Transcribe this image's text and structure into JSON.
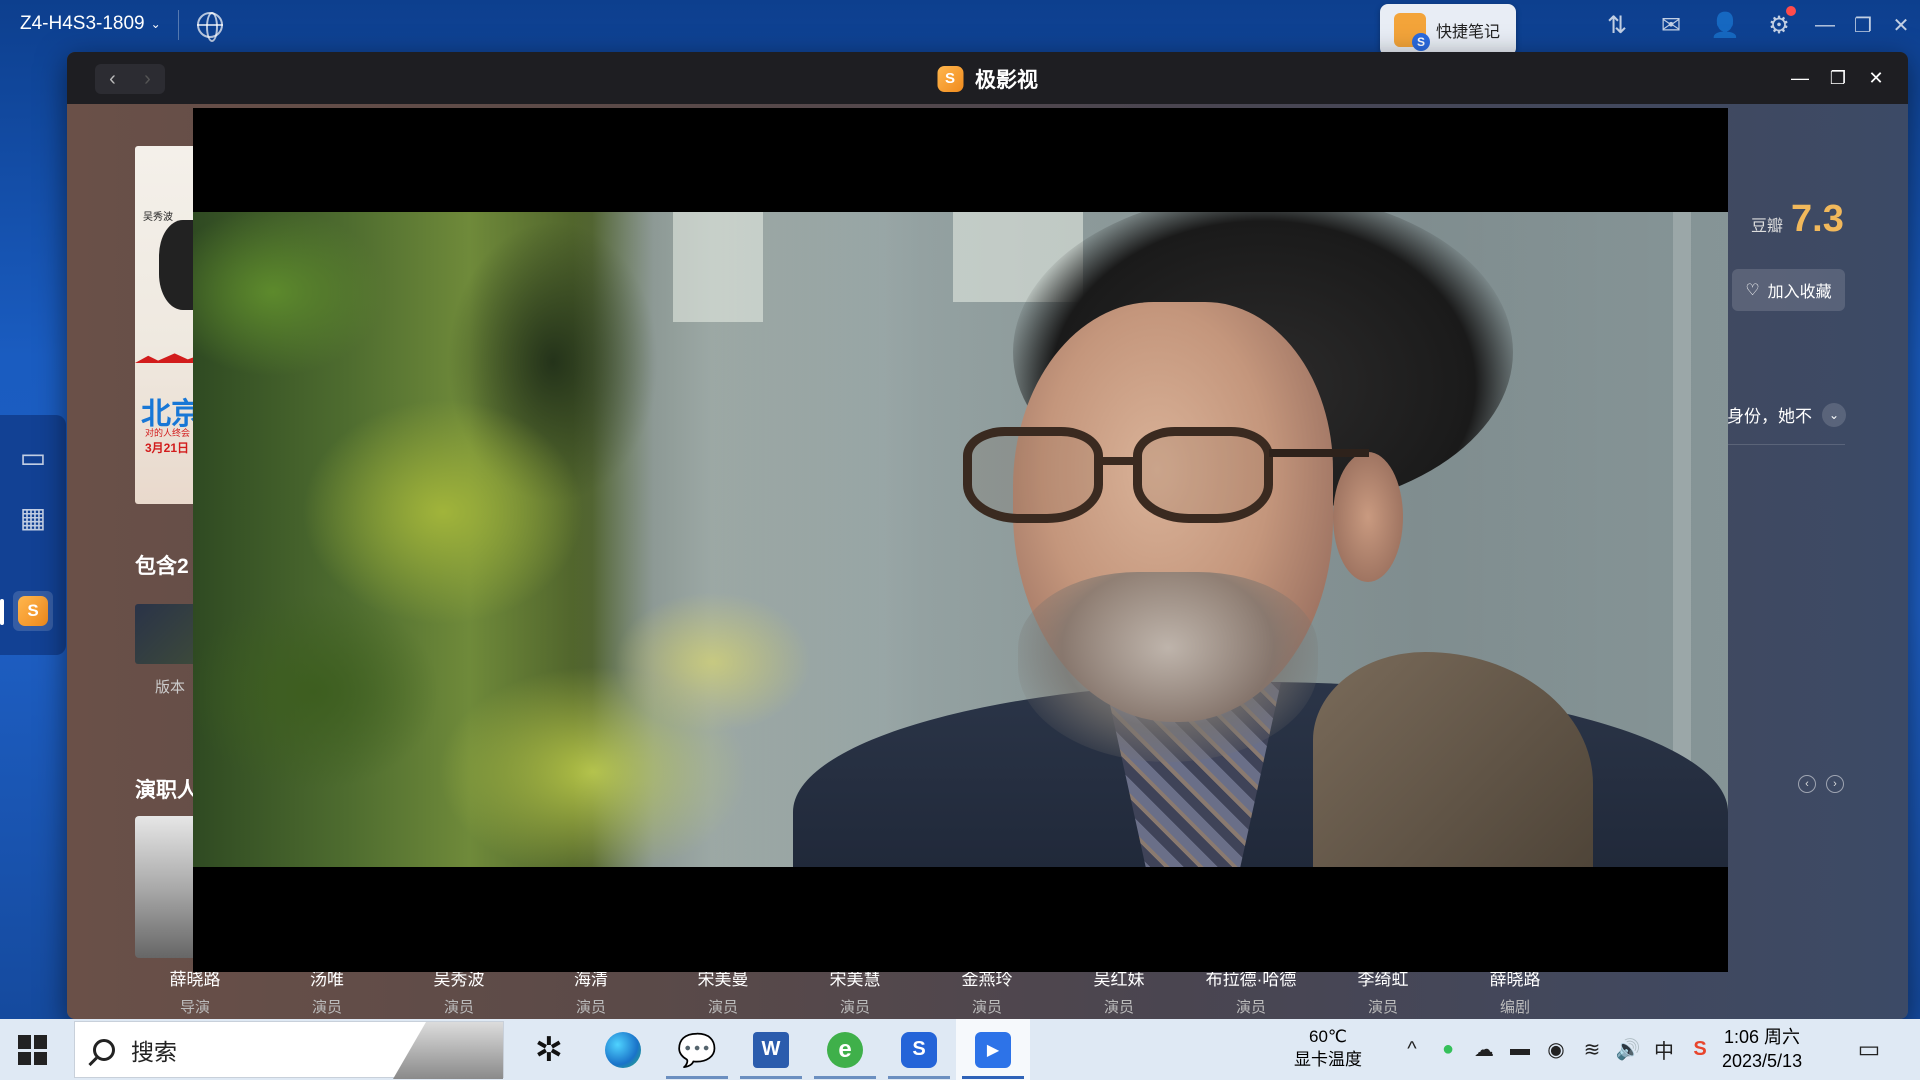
{
  "desktop": {
    "device_name": "Z4-H4S3-1809",
    "device_caret": "⌄",
    "quick_note_label": "快捷笔记",
    "top_icons": [
      "transfer-icon",
      "mail-icon",
      "user-icon",
      "settings-icon",
      "minimize-icon",
      "restore-icon",
      "close-icon"
    ]
  },
  "app": {
    "title": "极影视",
    "logo_glyph": "S",
    "nav_back": "‹",
    "nav_forward": "›",
    "win_min": "—",
    "win_max": "❐",
    "win_close": "✕"
  },
  "detail": {
    "poster": {
      "actor_name": "吴秀波",
      "title_text": "北京",
      "tagline": "对的人终会",
      "date": "3月21日"
    },
    "douban_label": "豆瓣",
    "douban_score": "7.3",
    "collect_label": "加入收藏",
    "collect_glyph": "♡",
    "description_tail": "身份，她不",
    "expand_glyph": "⌄",
    "versions_heading": "包含2",
    "version_label": "版本",
    "cast_heading": "演职人",
    "carousel_prev": "‹",
    "carousel_next": "›",
    "close_glyph": "✕",
    "cast": [
      {
        "name": "薛晓路",
        "role": "导演"
      },
      {
        "name": "汤唯",
        "role": "演员"
      },
      {
        "name": "吴秀波",
        "role": "演员"
      },
      {
        "name": "海清",
        "role": "演员"
      },
      {
        "name": "宋美曼",
        "role": "演员"
      },
      {
        "name": "宋美慧",
        "role": "演员"
      },
      {
        "name": "金燕玲",
        "role": "演员"
      },
      {
        "name": "吴红妹",
        "role": "演员"
      },
      {
        "name": "布拉德·哈德",
        "role": "演员"
      },
      {
        "name": "李绮虹",
        "role": "演员"
      },
      {
        "name": "薛晓路",
        "role": "编剧"
      }
    ]
  },
  "taskbar": {
    "search_placeholder": "搜索",
    "apps": [
      {
        "name": "pinwheel-app",
        "glyph": "✲",
        "running": false,
        "active": false
      },
      {
        "name": "edge-browser",
        "glyph": "",
        "running": false,
        "active": false
      },
      {
        "name": "wechat",
        "glyph": "💬",
        "running": true,
        "active": false
      },
      {
        "name": "word",
        "glyph": "W",
        "running": true,
        "active": false
      },
      {
        "name": "ie-browser",
        "glyph": "e",
        "running": true,
        "active": false
      },
      {
        "name": "nas-client",
        "glyph": "S",
        "running": true,
        "active": false
      },
      {
        "name": "video-player",
        "glyph": "▶",
        "running": true,
        "active": true
      }
    ],
    "temperature_value": "60℃",
    "temperature_label": "显卡温度",
    "tray": {
      "chevron": "^",
      "wechat": "●",
      "cloud": "☁",
      "battery": "▬",
      "qq": "◉",
      "wifi": "≋",
      "volume": "🔊",
      "ime": "中",
      "sogou": "S"
    },
    "time": "1:06 周六",
    "date": "2023/5/13",
    "notifications_glyph": "▭"
  }
}
